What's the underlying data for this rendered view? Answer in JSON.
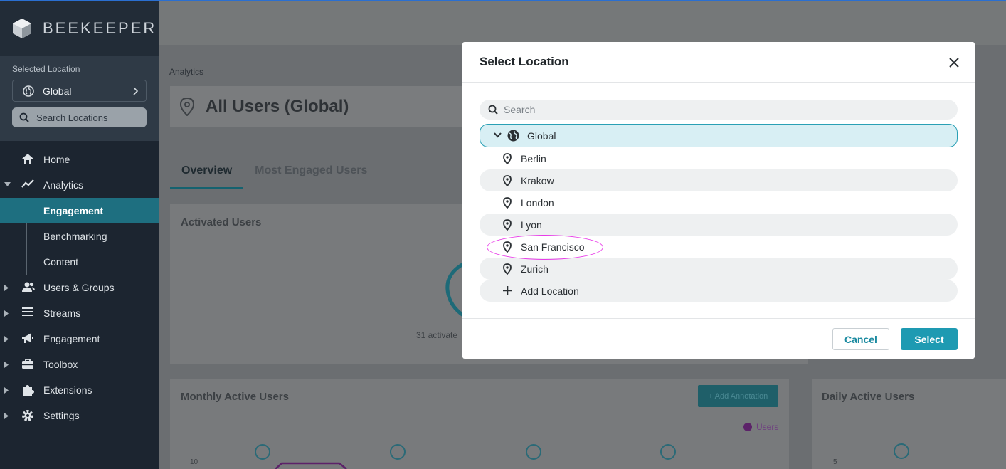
{
  "brand": {
    "name": "BEEKEEPER"
  },
  "sidebar": {
    "selected_location_caption": "Selected Location",
    "selected_location": "Global",
    "search_placeholder": "Search Locations",
    "nav": {
      "home": "Home",
      "analytics": "Analytics",
      "analytics_sub": [
        "Engagement",
        "Benchmarking",
        "Content"
      ],
      "users_groups": "Users & Groups",
      "streams": "Streams",
      "engagement": "Engagement",
      "toolbox": "Toolbox",
      "extensions": "Extensions",
      "settings": "Settings"
    }
  },
  "main": {
    "breadcrumb": "Analytics",
    "title": "All Users (Global)",
    "tabs": [
      "Overview",
      "Most Engaged Users"
    ],
    "cards": {
      "activated_users": "Activated Users",
      "activated_caption": "31 activate",
      "monthly_active_users": "Monthly Active Users",
      "add_annotation": "+ Add Annotation",
      "legend_users": "Users",
      "daily_active_users": "Daily Active Users",
      "axis_left": "10",
      "axis_right": "5"
    }
  },
  "modal": {
    "title": "Select Location",
    "search_placeholder": "Search",
    "root": "Global",
    "locations": [
      "Berlin",
      "Krakow",
      "London",
      "Lyon",
      "San Francisco",
      "Zurich"
    ],
    "add_location": "Add Location",
    "cancel": "Cancel",
    "select": "Select"
  },
  "colors": {
    "accent": "#1e9ab2",
    "sidebar": "#1c2530",
    "active_nav": "#1e6f80",
    "highlight": "#e83be8"
  }
}
